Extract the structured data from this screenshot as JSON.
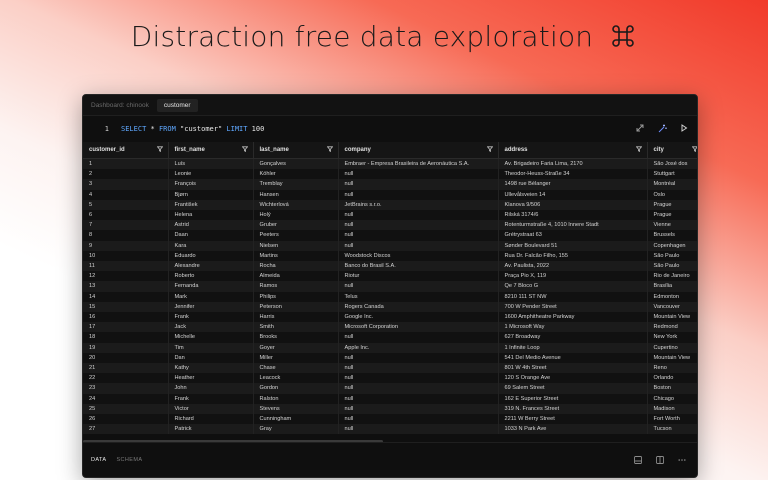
{
  "hero": {
    "title": "Distraction free data exploration",
    "icon": "command-key-icon"
  },
  "tabs": {
    "breadcrumb": "Dashboard: chinook",
    "active": "customer"
  },
  "editor": {
    "line": "1",
    "query": {
      "select": "SELECT",
      "star": " * ",
      "from": "FROM",
      "table": " \"customer\" ",
      "limit": "LIMIT",
      "count": " 100"
    }
  },
  "table": {
    "columns": [
      "customer_id",
      "first_name",
      "last_name",
      "company",
      "address",
      "city"
    ],
    "rows": [
      [
        "1",
        "Luís",
        "Gonçalves",
        "Embraer - Empresa Brasileira de Aeronáutica S.A.",
        "Av. Brigadeiro Faria Lima, 2170",
        "São José dos"
      ],
      [
        "2",
        "Leonie",
        "Köhler",
        "null",
        "Theodor-Heuss-Straße 34",
        "Stuttgart"
      ],
      [
        "3",
        "François",
        "Tremblay",
        "null",
        "1498 rue Bélanger",
        "Montréal"
      ],
      [
        "4",
        "Bjørn",
        "Hansen",
        "null",
        "Ullevålsveien 14",
        "Oslo"
      ],
      [
        "5",
        "František",
        "Wichterlová",
        "JetBrains s.r.o.",
        "Klanova 9/506",
        "Prague"
      ],
      [
        "6",
        "Helena",
        "Holý",
        "null",
        "Rilská 3174/6",
        "Prague"
      ],
      [
        "7",
        "Astrid",
        "Gruber",
        "null",
        "Rotenturmstraße 4, 1010 Innere Stadt",
        "Vienne"
      ],
      [
        "8",
        "Daan",
        "Peeters",
        "null",
        "Grétrystraat 63",
        "Brussels"
      ],
      [
        "9",
        "Kara",
        "Nielsen",
        "null",
        "Sønder Boulevard 51",
        "Copenhagen"
      ],
      [
        "10",
        "Eduardo",
        "Martins",
        "Woodstock Discos",
        "Rua Dr. Falcão Filho, 155",
        "São Paulo"
      ],
      [
        "11",
        "Alexandre",
        "Rocha",
        "Banco do Brasil S.A.",
        "Av. Paulista, 2022",
        "São Paulo"
      ],
      [
        "12",
        "Roberto",
        "Almeida",
        "Riotur",
        "Praça Pio X, 119",
        "Rio de Janeiro"
      ],
      [
        "13",
        "Fernanda",
        "Ramos",
        "null",
        "Qe 7 Bloco G",
        "Brasília"
      ],
      [
        "14",
        "Mark",
        "Philips",
        "Telus",
        "8210 111 ST NW",
        "Edmonton"
      ],
      [
        "15",
        "Jennifer",
        "Peterson",
        "Rogers Canada",
        "700 W Pender Street",
        "Vancouver"
      ],
      [
        "16",
        "Frank",
        "Harris",
        "Google Inc.",
        "1600 Amphitheatre Parkway",
        "Mountain View"
      ],
      [
        "17",
        "Jack",
        "Smith",
        "Microsoft Corporation",
        "1 Microsoft Way",
        "Redmond"
      ],
      [
        "18",
        "Michelle",
        "Brooks",
        "null",
        "627 Broadway",
        "New York"
      ],
      [
        "19",
        "Tim",
        "Goyer",
        "Apple Inc.",
        "1 Infinite Loop",
        "Cupertino"
      ],
      [
        "20",
        "Dan",
        "Miller",
        "null",
        "541 Del Medio Avenue",
        "Mountain View"
      ],
      [
        "21",
        "Kathy",
        "Chase",
        "null",
        "801 W 4th Street",
        "Reno"
      ],
      [
        "22",
        "Heather",
        "Leacock",
        "null",
        "120 S Orange Ave",
        "Orlando"
      ],
      [
        "23",
        "John",
        "Gordon",
        "null",
        "69 Salem Street",
        "Boston"
      ],
      [
        "24",
        "Frank",
        "Ralston",
        "null",
        "162 E Superior Street",
        "Chicago"
      ],
      [
        "25",
        "Victor",
        "Stevens",
        "null",
        "319 N. Frances Street",
        "Madison"
      ],
      [
        "26",
        "Richard",
        "Cunningham",
        "null",
        "2211 W Berry Street",
        "Fort Worth"
      ],
      [
        "27",
        "Patrick",
        "Gray",
        "null",
        "1033 N Park Ave",
        "Tucson"
      ]
    ]
  },
  "footer": {
    "tab_data": "DATA",
    "tab_schema": "SCHEMA"
  },
  "colors": {
    "keyword": "#5fa8ff",
    "accent": "#f13a2a"
  }
}
